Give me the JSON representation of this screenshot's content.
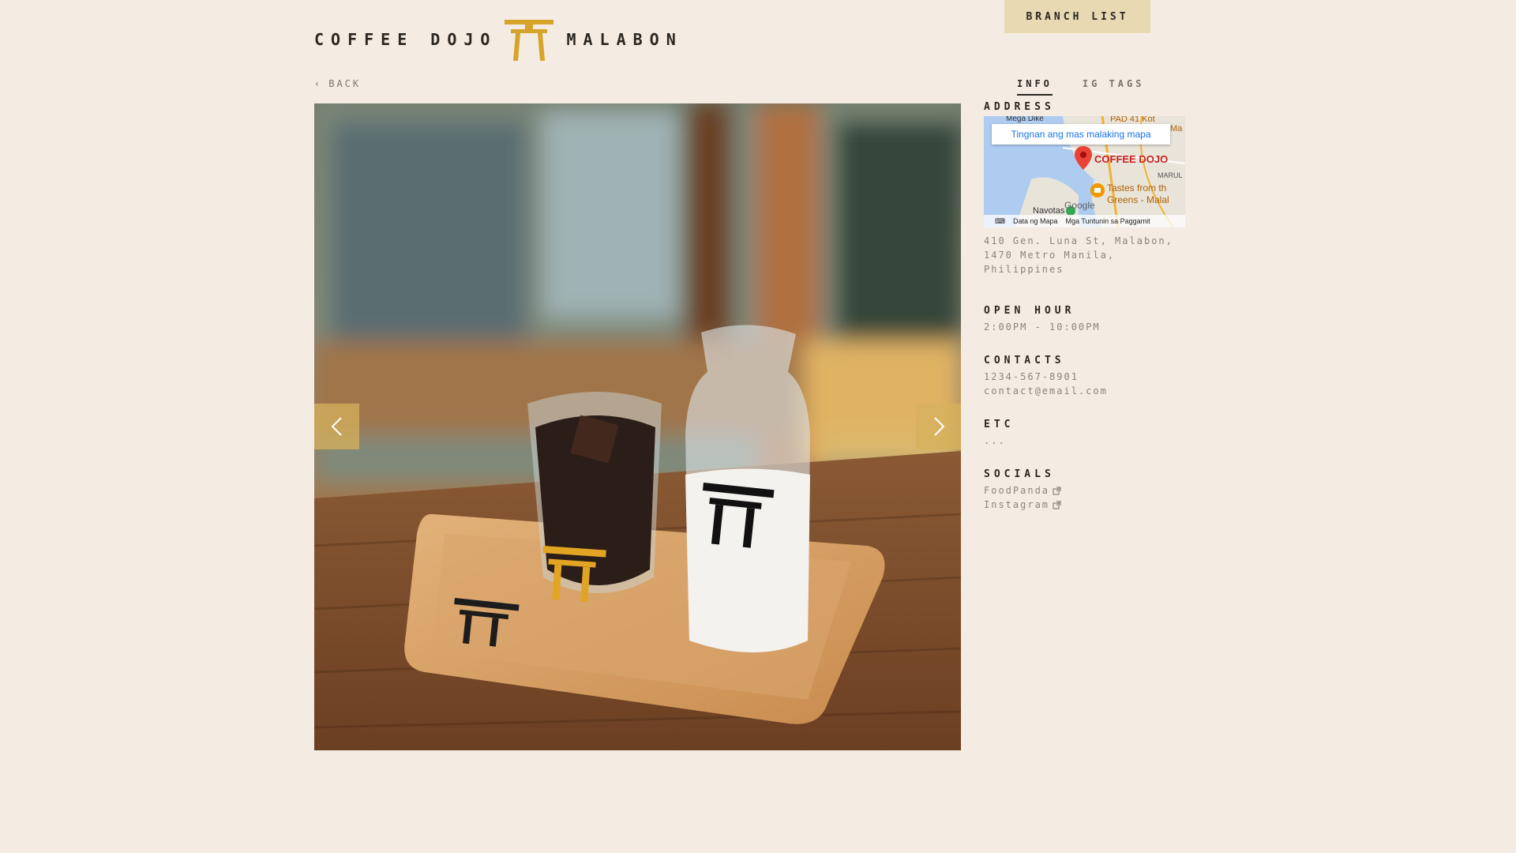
{
  "header": {
    "brand_left": "COFFEE DOJO",
    "brand_right": "MALABON",
    "branch_button": "BRANCH LIST",
    "back_label": "BACK"
  },
  "tabs": [
    {
      "label": "INFO",
      "active": true
    },
    {
      "label": "IG TAGS",
      "active": false
    }
  ],
  "map": {
    "view_larger": "Tingnan ang mas malaking mapa",
    "pin_label": "COFFEE DOJO",
    "poi_label_1": "Tastes from th",
    "poi_label_2": "Greens - Malal",
    "place_navotas": "Navotas",
    "place_marul": "MARUL",
    "place_mega": "Mega Dike",
    "place_pad": "PAD 41 Kot",
    "place_ma": "Ma",
    "google": "Google",
    "footer_data": "Data ng Mapa",
    "footer_terms": "Mga Tuntunin sa Paggamit"
  },
  "info": {
    "address_title": "ADDRESS",
    "address_text": "410 Gen. Luna St, Malabon, 1470 Metro Manila, Philippines",
    "hours_title": "OPEN HOUR",
    "hours_text": "2:00PM - 10:00PM",
    "contacts_title": "CONTACTS",
    "phone": "1234-567-8901",
    "email": "contact@email.com",
    "etc_title": "ETC",
    "etc_text": "...",
    "socials_title": "SOCIALS",
    "social_1": "FoodPanda",
    "social_2": "Instagram"
  },
  "colors": {
    "background": "#f4ece2",
    "accent_gold": "#d6a42a",
    "button_bg": "#e8d9b2"
  }
}
